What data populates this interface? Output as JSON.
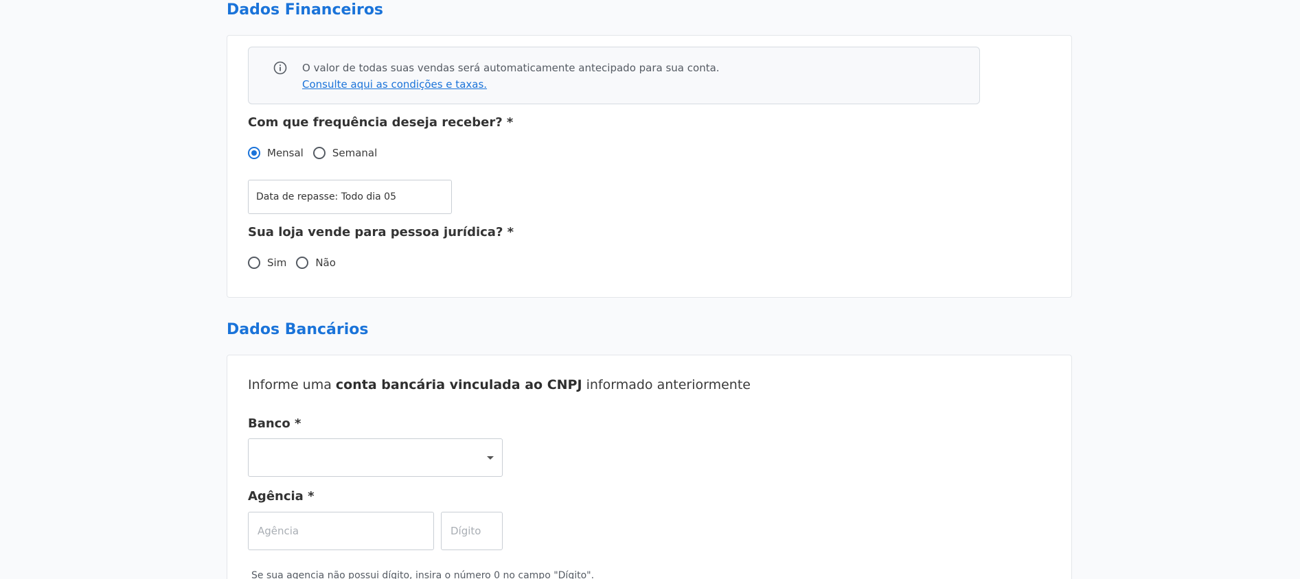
{
  "financial": {
    "title": "Dados Financeiros",
    "info_text": "O valor de todas suas vendas será automaticamente antecipado para sua conta.",
    "info_link": "Consulte aqui as condições e taxas.",
    "frequency_question": "Com que frequência deseja receber? *",
    "frequency_options": [
      "Mensal",
      "Semanal"
    ],
    "frequency_selected": "Mensal",
    "payout_date": "Data de repasse: Todo dia 05",
    "legal_entity_question": "Sua loja vende para pessoa jurídica? *",
    "legal_entity_options": [
      "Sim",
      "Não"
    ]
  },
  "banking": {
    "title": "Dados Bancários",
    "lead_prefix": "Informe uma ",
    "lead_bold": "conta bancária vinculada ao CNPJ",
    "lead_suffix": " informado anteriormente",
    "bank_label": "Banco *",
    "bank_value": "",
    "agency_label": "Agência *",
    "agency_placeholder": "Agência",
    "digit_placeholder": "Dígito",
    "agency_hint": "Se sua agencia não possui dígito, insira o número 0 no campo \"Dígito\"."
  },
  "colors": {
    "accent": "#1a73d9",
    "background": "#f9fafc",
    "card_border": "#e3e6ea"
  }
}
